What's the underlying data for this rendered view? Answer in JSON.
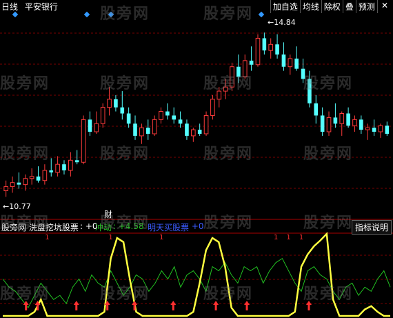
{
  "toolbar": {
    "period": "日线",
    "stock_name": "平安银行",
    "buttons": [
      "加自选",
      "均线",
      "除权",
      "叠",
      "预测"
    ],
    "close_icon": "close-icon"
  },
  "price_chart": {
    "high_label": "14.84",
    "low_label": "10.77",
    "event_marker": "财"
  },
  "indicator": {
    "name": "股旁网 洗盘挖坑股票",
    "name_value": ": +0",
    "line1_label": "冲动",
    "line1_value": ": +4.58",
    "line2_label": "明天买股票",
    "line2_value": ": +0",
    "help_button": "指标说明",
    "signal_marks": [
      "1",
      "1",
      "1",
      "1",
      "1",
      "1"
    ]
  },
  "watermark_text": "股旁网",
  "colors": {
    "up_candle": "#ff3b3b",
    "down_candle": "#54ffff",
    "yellow_line": "#ffff40",
    "green_line": "#21c021",
    "blue_label": "#3b5bff",
    "arrow": "#ff3030",
    "grid": "#7a0000",
    "diamond": "#3399ff"
  },
  "chart_data": [
    {
      "type": "candlestick",
      "ylim": [
        10.5,
        15.2
      ],
      "candles": [
        {
          "o": 10.95,
          "h": 11.2,
          "l": 10.8,
          "c": 11.05
        },
        {
          "o": 11.05,
          "h": 11.3,
          "l": 10.9,
          "c": 11.15
        },
        {
          "o": 11.15,
          "h": 11.4,
          "l": 11.0,
          "c": 11.1
        },
        {
          "o": 11.1,
          "h": 11.35,
          "l": 10.95,
          "c": 11.25
        },
        {
          "o": 11.25,
          "h": 11.5,
          "l": 11.1,
          "c": 11.3
        },
        {
          "o": 11.3,
          "h": 11.55,
          "l": 11.15,
          "c": 11.2
        },
        {
          "o": 11.2,
          "h": 11.6,
          "l": 11.1,
          "c": 11.45
        },
        {
          "o": 11.45,
          "h": 11.75,
          "l": 11.3,
          "c": 11.4
        },
        {
          "o": 11.4,
          "h": 11.8,
          "l": 11.3,
          "c": 11.6
        },
        {
          "o": 11.6,
          "h": 11.7,
          "l": 11.35,
          "c": 11.45
        },
        {
          "o": 11.45,
          "h": 11.9,
          "l": 11.3,
          "c": 11.7
        },
        {
          "o": 11.7,
          "h": 11.95,
          "l": 11.6,
          "c": 11.65
        },
        {
          "o": 11.65,
          "h": 12.8,
          "l": 11.6,
          "c": 12.7
        },
        {
          "o": 12.7,
          "h": 12.9,
          "l": 12.3,
          "c": 12.4
        },
        {
          "o": 12.4,
          "h": 12.9,
          "l": 12.35,
          "c": 12.6
        },
        {
          "o": 12.6,
          "h": 13.1,
          "l": 12.5,
          "c": 13.0
        },
        {
          "o": 13.0,
          "h": 13.5,
          "l": 12.8,
          "c": 13.2
        },
        {
          "o": 13.2,
          "h": 13.3,
          "l": 12.9,
          "c": 13.0
        },
        {
          "o": 13.0,
          "h": 13.4,
          "l": 12.7,
          "c": 12.85
        },
        {
          "o": 12.85,
          "h": 13.0,
          "l": 12.5,
          "c": 12.6
        },
        {
          "o": 12.6,
          "h": 12.8,
          "l": 12.2,
          "c": 12.3
        },
        {
          "o": 12.3,
          "h": 12.6,
          "l": 12.1,
          "c": 12.5
        },
        {
          "o": 12.5,
          "h": 12.7,
          "l": 12.2,
          "c": 12.35
        },
        {
          "o": 12.35,
          "h": 12.8,
          "l": 12.3,
          "c": 12.7
        },
        {
          "o": 12.7,
          "h": 13.0,
          "l": 12.6,
          "c": 12.9
        },
        {
          "o": 12.9,
          "h": 13.1,
          "l": 12.7,
          "c": 12.8
        },
        {
          "o": 12.8,
          "h": 13.0,
          "l": 12.6,
          "c": 12.7
        },
        {
          "o": 12.7,
          "h": 12.9,
          "l": 12.5,
          "c": 12.6
        },
        {
          "o": 12.6,
          "h": 12.7,
          "l": 12.2,
          "c": 12.3
        },
        {
          "o": 12.3,
          "h": 12.5,
          "l": 12.15,
          "c": 12.45
        },
        {
          "o": 12.45,
          "h": 12.6,
          "l": 12.3,
          "c": 12.35
        },
        {
          "o": 12.35,
          "h": 12.9,
          "l": 12.3,
          "c": 12.8
        },
        {
          "o": 12.8,
          "h": 13.3,
          "l": 12.7,
          "c": 13.2
        },
        {
          "o": 13.2,
          "h": 13.5,
          "l": 13.0,
          "c": 13.4
        },
        {
          "o": 13.4,
          "h": 13.7,
          "l": 13.2,
          "c": 13.5
        },
        {
          "o": 13.5,
          "h": 14.1,
          "l": 13.4,
          "c": 14.0
        },
        {
          "o": 14.0,
          "h": 14.3,
          "l": 13.6,
          "c": 13.75
        },
        {
          "o": 13.75,
          "h": 14.3,
          "l": 13.7,
          "c": 14.15
        },
        {
          "o": 14.15,
          "h": 14.5,
          "l": 13.9,
          "c": 14.05
        },
        {
          "o": 14.05,
          "h": 14.8,
          "l": 14.0,
          "c": 14.7
        },
        {
          "o": 14.7,
          "h": 14.84,
          "l": 14.3,
          "c": 14.4
        },
        {
          "o": 14.4,
          "h": 14.7,
          "l": 14.2,
          "c": 14.55
        },
        {
          "o": 14.55,
          "h": 14.8,
          "l": 14.2,
          "c": 14.3
        },
        {
          "o": 14.3,
          "h": 14.6,
          "l": 13.9,
          "c": 14.0
        },
        {
          "o": 14.0,
          "h": 14.3,
          "l": 13.8,
          "c": 14.2
        },
        {
          "o": 14.2,
          "h": 14.5,
          "l": 13.9,
          "c": 13.95
        },
        {
          "o": 13.95,
          "h": 14.2,
          "l": 13.6,
          "c": 13.7
        },
        {
          "o": 13.7,
          "h": 13.9,
          "l": 13.0,
          "c": 13.1
        },
        {
          "o": 13.1,
          "h": 13.3,
          "l": 12.6,
          "c": 12.8
        },
        {
          "o": 12.8,
          "h": 13.0,
          "l": 12.3,
          "c": 12.4
        },
        {
          "o": 12.4,
          "h": 12.9,
          "l": 12.3,
          "c": 12.75
        },
        {
          "o": 12.75,
          "h": 13.1,
          "l": 12.5,
          "c": 12.6
        },
        {
          "o": 12.6,
          "h": 12.9,
          "l": 12.3,
          "c": 12.85
        },
        {
          "o": 12.85,
          "h": 13.0,
          "l": 12.5,
          "c": 12.55
        },
        {
          "o": 12.55,
          "h": 12.8,
          "l": 12.4,
          "c": 12.7
        },
        {
          "o": 12.7,
          "h": 12.8,
          "l": 12.35,
          "c": 12.45
        },
        {
          "o": 12.45,
          "h": 12.6,
          "l": 12.2,
          "c": 12.5
        },
        {
          "o": 12.5,
          "h": 12.7,
          "l": 12.3,
          "c": 12.4
        },
        {
          "o": 12.4,
          "h": 12.6,
          "l": 12.25,
          "c": 12.55
        },
        {
          "o": 12.55,
          "h": 12.65,
          "l": 12.3,
          "c": 12.35
        }
      ]
    },
    {
      "type": "line",
      "ylim": [
        0,
        100
      ],
      "series": [
        {
          "name": "洗盘挖坑股票",
          "values": [
            0,
            0,
            0,
            0,
            0,
            5,
            20,
            0,
            0,
            0,
            0,
            0,
            0,
            0,
            0,
            0,
            5,
            70,
            95,
            90,
            45,
            5,
            0,
            0,
            0,
            0,
            0,
            0,
            0,
            0,
            5,
            40,
            80,
            95,
            90,
            60,
            10,
            0,
            0,
            0,
            0,
            0,
            0,
            0,
            0,
            0,
            5,
            60,
            75,
            85,
            92,
            100,
            20,
            0,
            0,
            0,
            0,
            8,
            12,
            5,
            0,
            0
          ]
        },
        {
          "name": "冲动",
          "values": [
            45,
            35,
            30,
            20,
            10,
            25,
            40,
            30,
            20,
            25,
            15,
            35,
            45,
            30,
            50,
            40,
            35,
            55,
            40,
            25,
            35,
            50,
            45,
            30,
            40,
            55,
            45,
            60,
            35,
            50,
            55,
            45,
            30,
            60,
            55,
            65,
            50,
            40,
            60,
            55,
            60,
            40,
            55,
            65,
            70,
            55,
            40,
            30,
            55,
            60,
            50,
            45,
            30,
            20,
            35,
            40,
            25,
            35,
            30,
            45,
            55,
            35
          ]
        }
      ],
      "arrow_positions": [
        6,
        9,
        19,
        27,
        34,
        44,
        55,
        63,
        79
      ],
      "signal_positions": [
        7,
        17,
        25,
        43,
        45,
        47
      ]
    }
  ]
}
